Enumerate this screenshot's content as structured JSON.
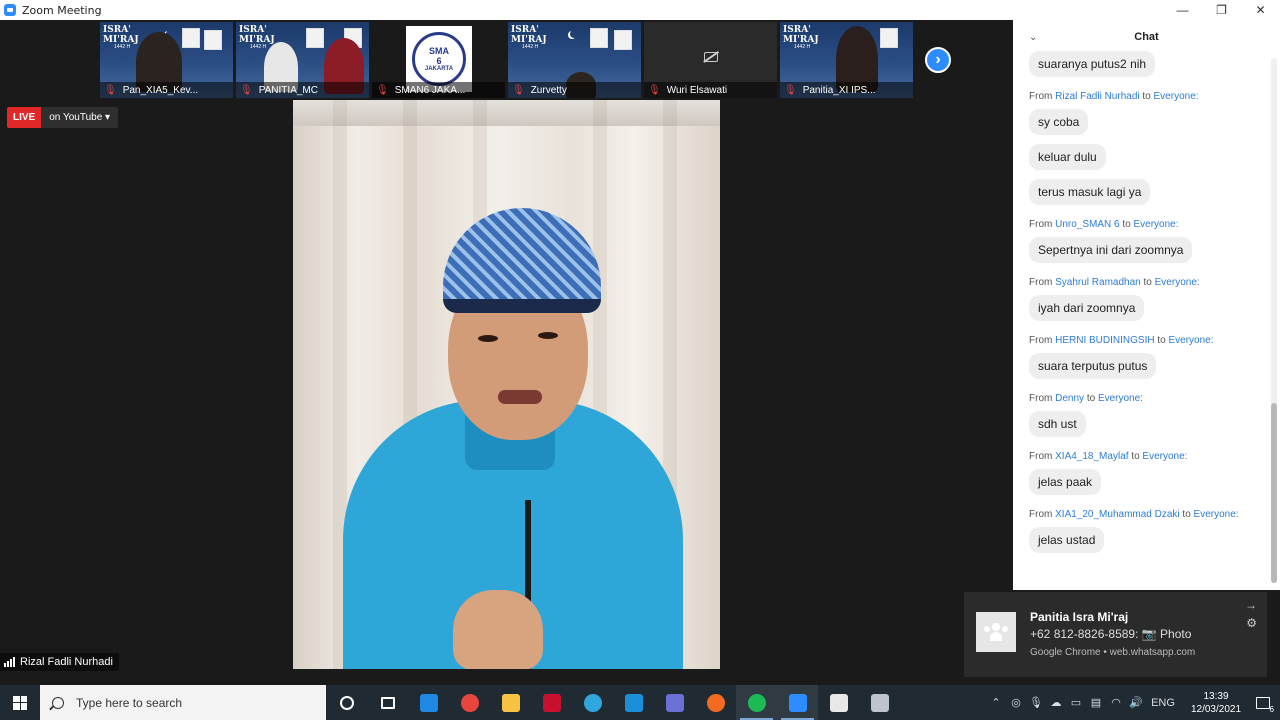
{
  "window": {
    "title": "Zoom Meeting",
    "minimize": "—",
    "maximize": "❐",
    "close": "✕"
  },
  "thumbnails": [
    {
      "name": "Pan_XIA5_Kev...",
      "poster": true
    },
    {
      "name": "PANITIA_MC",
      "poster": true
    },
    {
      "name": "SMAN6 JAKA...",
      "poster": false
    },
    {
      "name": "Zurvetty",
      "poster": true
    },
    {
      "name": "Wuri Elsawati",
      "poster": false
    },
    {
      "name": "Panitia_XI IPS...",
      "poster": true
    }
  ],
  "poster_text": {
    "line1": "ISRA'",
    "line2": "MI'RAJ",
    "year": "1442 H"
  },
  "logo_text": {
    "top": "SMA",
    "num": "6",
    "bottom": "JAKARTA"
  },
  "live": {
    "badge": "LIVE",
    "destination": "on YouTube ▾"
  },
  "speaker": {
    "name": "Rizal Fadli Nurhadi"
  },
  "chat": {
    "title": "Chat",
    "messages": [
      {
        "from": "",
        "to": "",
        "texts": [
          "suaranya putus2 nih"
        ]
      },
      {
        "from": "Rizal Fadli Nurhadi",
        "to": "Everyone:",
        "texts": [
          "sy coba",
          "keluar dulu",
          "terus masuk lagi ya"
        ]
      },
      {
        "from": "Unro_SMAN 6",
        "to": "Everyone:",
        "texts": [
          "Sepertnya ini dari zoomnya"
        ]
      },
      {
        "from": "Syahrul Ramadhan",
        "to": "Everyone:",
        "texts": [
          "iyah dari zoomnya"
        ]
      },
      {
        "from": "HERNI BUDININGSIH",
        "to": "Everyone:",
        "texts": [
          "suara terputus putus"
        ]
      },
      {
        "from": "Denny",
        "to": "Everyone:",
        "texts": [
          "sdh ust"
        ]
      },
      {
        "from": "XIA4_18_Maylaf",
        "to": "Everyone:",
        "texts": [
          "jelas paak"
        ]
      },
      {
        "from": "XIA1_20_Muhammad Dzaki",
        "to": "Everyone:",
        "texts": [
          "jelas ustad"
        ]
      }
    ],
    "from_word": "From",
    "to_word": "to"
  },
  "notification": {
    "title": "Panitia Isra Mi'raj",
    "body": "+62 812-8826-8589: 📷 Photo",
    "source": "Google Chrome • web.whatsapp.com"
  },
  "taskbar": {
    "search_placeholder": "Type here to search",
    "apps": [
      {
        "name": "cortana",
        "color": "#ffffff"
      },
      {
        "name": "task-view",
        "color": "#ffffff"
      },
      {
        "name": "mail",
        "color": "#1e88e5"
      },
      {
        "name": "chrome",
        "color": "#e8453c"
      },
      {
        "name": "file-explorer",
        "color": "#f6c343"
      },
      {
        "name": "mcafee",
        "color": "#c8102e"
      },
      {
        "name": "edge",
        "color": "#2fa6de"
      },
      {
        "name": "l-app",
        "color": "#1b8fd8"
      },
      {
        "name": "teams-like",
        "color": "#6b6fd6"
      },
      {
        "name": "brave-like",
        "color": "#f36b21"
      },
      {
        "name": "spotify",
        "color": "#1db954"
      },
      {
        "name": "zoom",
        "color": "#2d8cff"
      },
      {
        "name": "paint",
        "color": "#e8e8e8"
      },
      {
        "name": "shield-app",
        "color": "#bfc5cc"
      }
    ],
    "tray": {
      "lang": "ENG",
      "time": "13:39",
      "date": "12/03/2021",
      "notif_count": "6"
    }
  },
  "colors": {
    "accent": "#2d8cff",
    "live_red": "#e02828",
    "chat_name": "#2d7cd6",
    "spotify": "#1db954"
  }
}
